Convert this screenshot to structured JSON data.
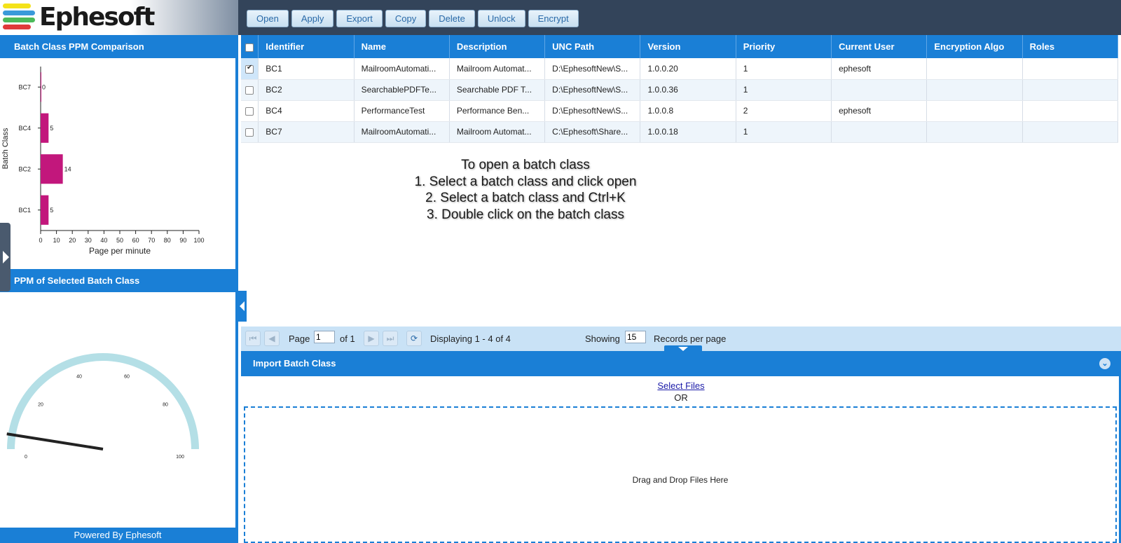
{
  "app": {
    "logo_text": "Ephesoft",
    "logo_colors": [
      "#f4e21a",
      "#3a9ad9",
      "#4cba5a",
      "#e03a3a"
    ]
  },
  "toolbar": {
    "buttons": [
      "Open",
      "Apply",
      "Export",
      "Copy",
      "Delete",
      "Unlock",
      "Encrypt"
    ]
  },
  "left": {
    "chart_title": "Batch Class PPM Comparison",
    "gauge_title": "PPM of Selected Batch Class",
    "footer": "Powered By Ephesoft"
  },
  "chart_data": [
    {
      "type": "bar",
      "orientation": "horizontal",
      "title": "Batch Class PPM Comparison",
      "categories": [
        "BC1",
        "BC2",
        "BC4",
        "BC7"
      ],
      "values": [
        5,
        14,
        5,
        0
      ],
      "data_labels": [
        "5",
        "14",
        "5",
        "0"
      ],
      "xlabel": "Page per minute",
      "ylabel": "Batch Class",
      "xlim": [
        0,
        100
      ],
      "xticks": [
        "0",
        "10",
        "20",
        "30",
        "40",
        "50",
        "60",
        "70",
        "80",
        "90",
        "100"
      ],
      "bar_color": "#c2177c"
    },
    {
      "type": "gauge",
      "title": "PPM of Selected Batch Class",
      "min": 0,
      "max": 100,
      "tick_labels": [
        "0",
        "20",
        "40",
        "60",
        "80",
        "100"
      ],
      "value": 5,
      "arc_color": "#b4dfe6",
      "needle_color": "#222222"
    }
  ],
  "grid": {
    "columns": [
      "Identifier",
      "Name",
      "Description",
      "UNC Path",
      "Version",
      "Priority",
      "Current User",
      "Encryption Algo",
      "Roles"
    ],
    "rows": [
      {
        "checked": true,
        "cells": [
          "BC1",
          "MailroomAutomati...",
          "Mailroom Automat...",
          "D:\\EphesoftNew\\S...",
          "1.0.0.20",
          "1",
          "ephesoft",
          "",
          ""
        ]
      },
      {
        "checked": false,
        "cells": [
          "BC2",
          "SearchablePDFTe...",
          "Searchable PDF T...",
          "D:\\EphesoftNew\\S...",
          "1.0.0.36",
          "1",
          "",
          "",
          ""
        ]
      },
      {
        "checked": false,
        "cells": [
          "BC4",
          "PerformanceTest",
          "Performance Ben...",
          "D:\\EphesoftNew\\S...",
          "1.0.0.8",
          "2",
          "ephesoft",
          "",
          ""
        ]
      },
      {
        "checked": false,
        "cells": [
          "BC7",
          "MailroomAutomati...",
          "Mailroom Automat...",
          "C:\\Ephesoft\\Share...",
          "1.0.0.18",
          "1",
          "",
          "",
          ""
        ]
      }
    ]
  },
  "instructions": {
    "line1": "To open a batch class",
    "line2": "1. Select a batch class and click open",
    "line3": "2. Select a batch class and Ctrl+K",
    "line4": "3. Double click on the batch class"
  },
  "pager": {
    "page_label": "Page",
    "page_value": "1",
    "of_label": "of 1",
    "displaying": "Displaying 1 - 4 of 4",
    "showing_label": "Showing",
    "records_value": "15",
    "records_label": "Records per page"
  },
  "import": {
    "title": "Import Batch Class",
    "select_files": "Select Files",
    "or": "OR",
    "drop_text": "Drag and Drop Files Here"
  }
}
